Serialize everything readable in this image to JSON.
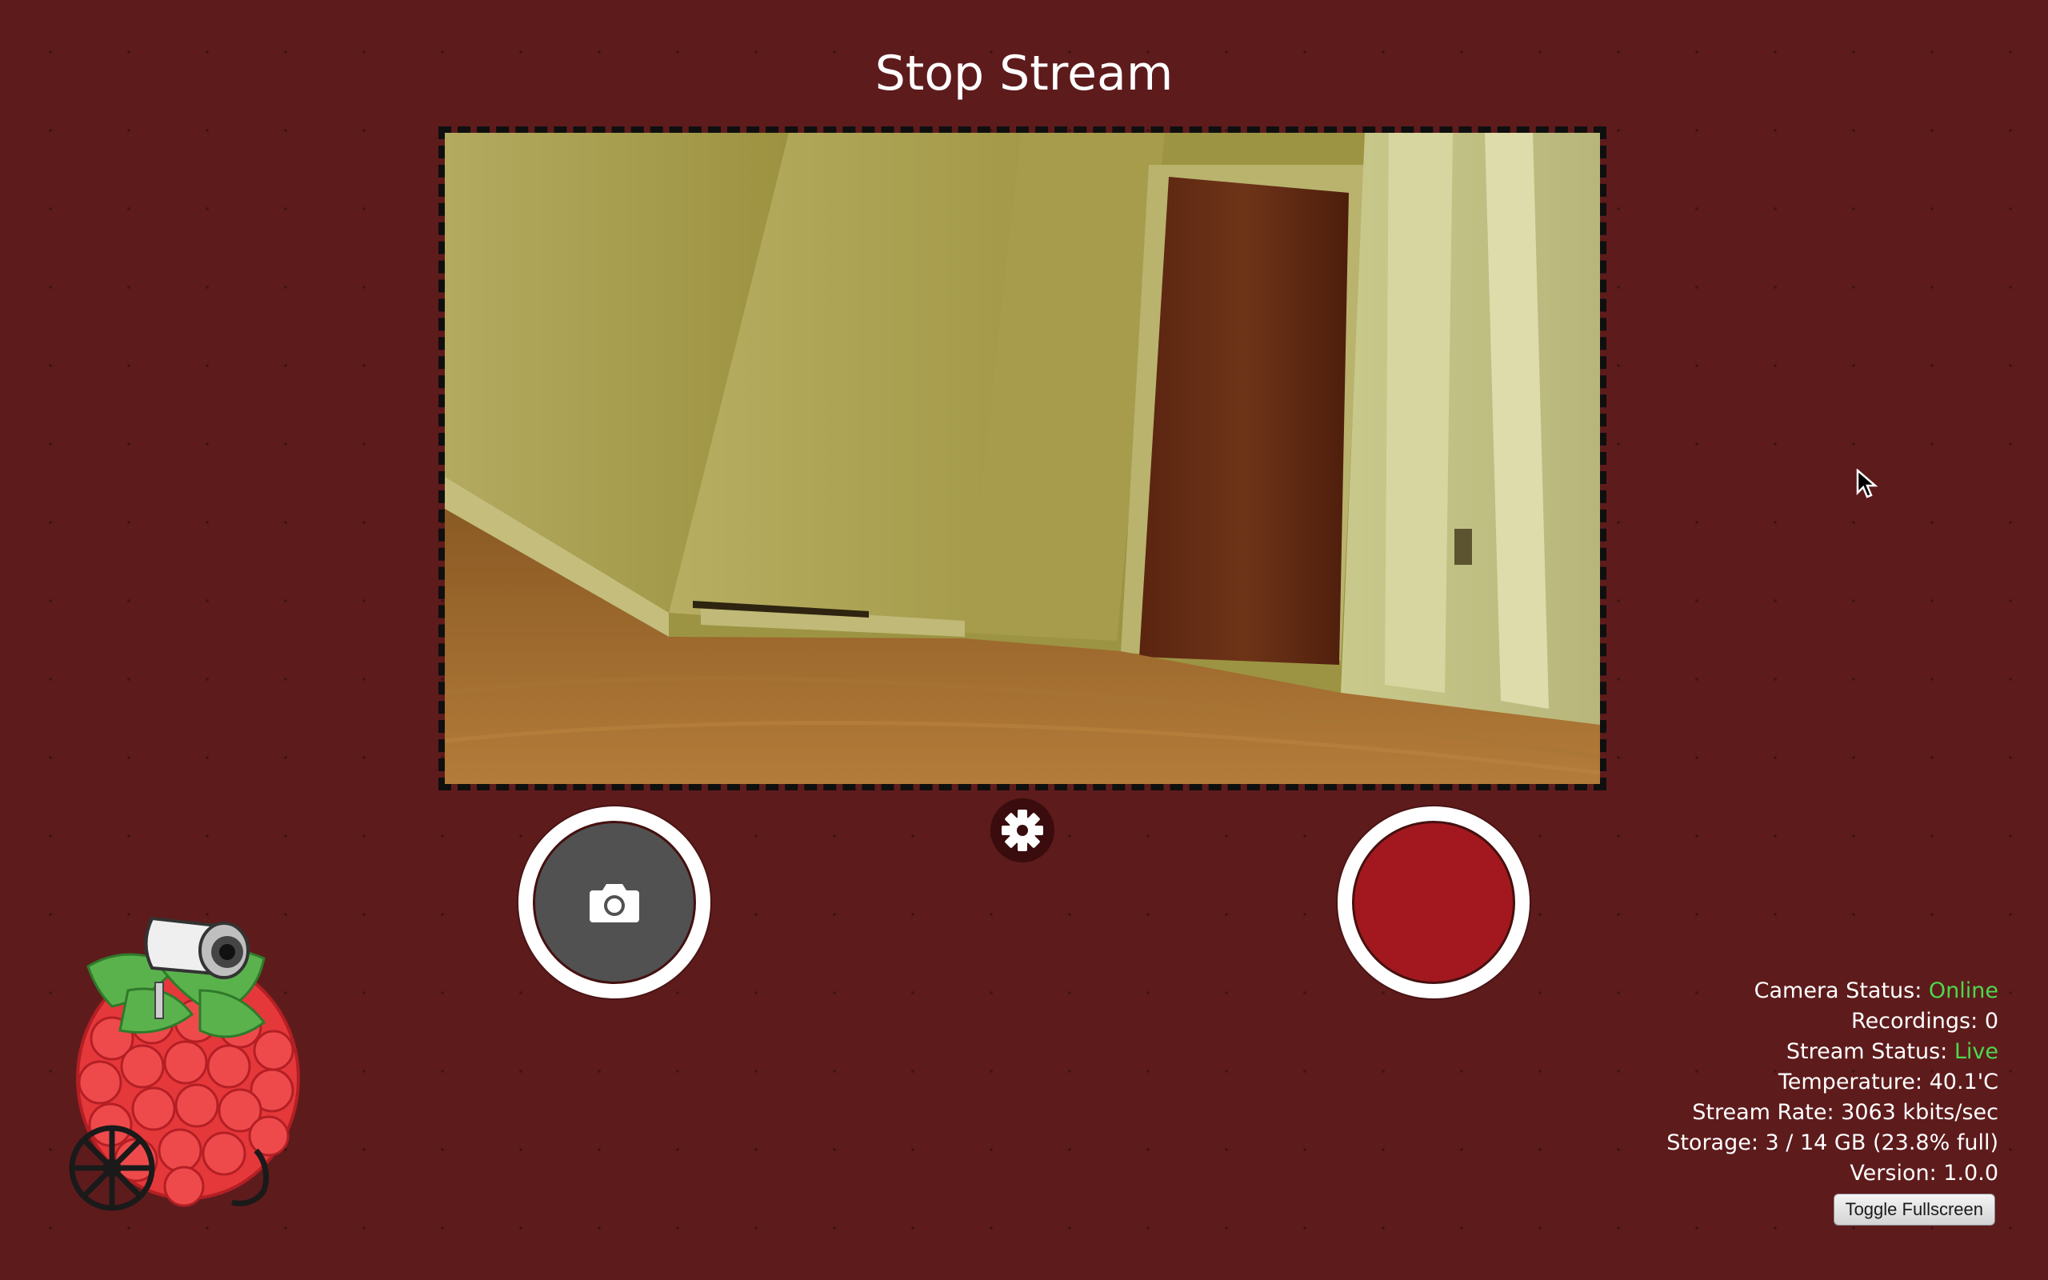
{
  "header": {
    "stream_button_label": "Stop Stream"
  },
  "stream": {
    "scene_description_icon": "camera-feed-hallway"
  },
  "controls": {
    "snapshot_icon": "camera-icon",
    "settings_icon": "gear-icon",
    "record_color": "#a3181e"
  },
  "status": {
    "camera_status_label": "Camera Status:",
    "camera_status_value": "Online",
    "recordings_label": "Recordings:",
    "recordings_value": "0",
    "stream_status_label": "Stream Status:",
    "stream_status_value": "Live",
    "temperature_label": "Temperature:",
    "temperature_value": "40.1'C",
    "stream_rate_label": "Stream Rate:",
    "stream_rate_value": "3063 kbits/sec",
    "storage_label": "Storage:",
    "storage_value": "3 / 14 GB (23.8% full)",
    "version_label": "Version:",
    "version_value": "1.0.0"
  },
  "footer": {
    "toggle_fullscreen_label": "Toggle Fullscreen"
  },
  "colors": {
    "background": "#5e1b1c",
    "status_ok": "#4cd94c"
  }
}
